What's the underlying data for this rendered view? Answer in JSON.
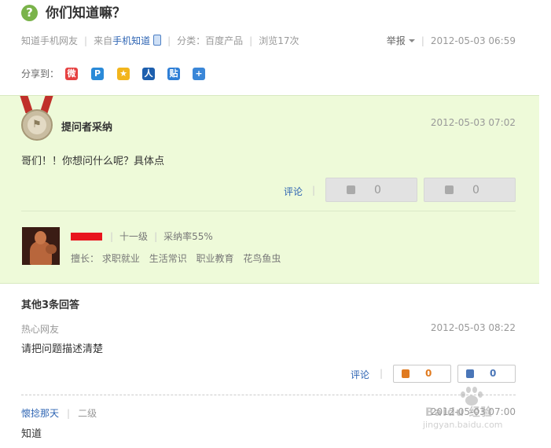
{
  "question": {
    "icon_glyph": "?",
    "title": "你们知道嘛？",
    "author": "知道手机网友",
    "from_prefix": "来自",
    "from_link": "手机知道",
    "category": "分类：百度产品",
    "views": "浏览17次",
    "report_label": "举报",
    "time": "2012-05-03 06:59"
  },
  "share": {
    "label": "分享到：",
    "icons": [
      {
        "name": "weibo-icon",
        "glyph": "微",
        "color": "#e64141"
      },
      {
        "name": "qzone-p-icon",
        "glyph": "P",
        "color": "#2a8ad8"
      },
      {
        "name": "qzone-star-icon",
        "glyph": "★",
        "color": "#f2b51c"
      },
      {
        "name": "renren-icon",
        "glyph": "人",
        "color": "#1d5fae"
      },
      {
        "name": "tieba-icon",
        "glyph": "贴",
        "color": "#2f7fd6"
      },
      {
        "name": "more-share-icon",
        "glyph": "+",
        "color": "#3a87d8"
      }
    ]
  },
  "accepted": {
    "title": "提问者采纳",
    "time": "2012-05-03 07:02",
    "text": "哥们！！你想问什么呢？具体点",
    "comment_label": "评论",
    "up_count": "0",
    "down_count": "0",
    "user_level": "十一级",
    "accept_rate": "采纳率55%",
    "skills_label": "擅长：",
    "skills": [
      "求职就业",
      "生活常识",
      "职业教育",
      "花鸟鱼虫"
    ]
  },
  "other": {
    "title": "其他3条回答",
    "answers": [
      {
        "user": "热心网友",
        "time": "2012-05-03 08:22",
        "text": "请把问题描述清楚",
        "comment_label": "评论",
        "up_count": "0",
        "down_count": "0"
      },
      {
        "user": "懷捻那天",
        "level": "二级",
        "time": "2012-05-03 07:00",
        "text": "知道"
      }
    ]
  },
  "watermark": {
    "text": "Baidu 经验",
    "url": "jingyan.baidu.com"
  },
  "colors": {
    "accent_green": "#7ab34a",
    "accepted_bg": "#eefad9",
    "link_blue": "#2d64b3",
    "up_orange": "#e07a1f",
    "down_blue": "#4a76b8"
  }
}
